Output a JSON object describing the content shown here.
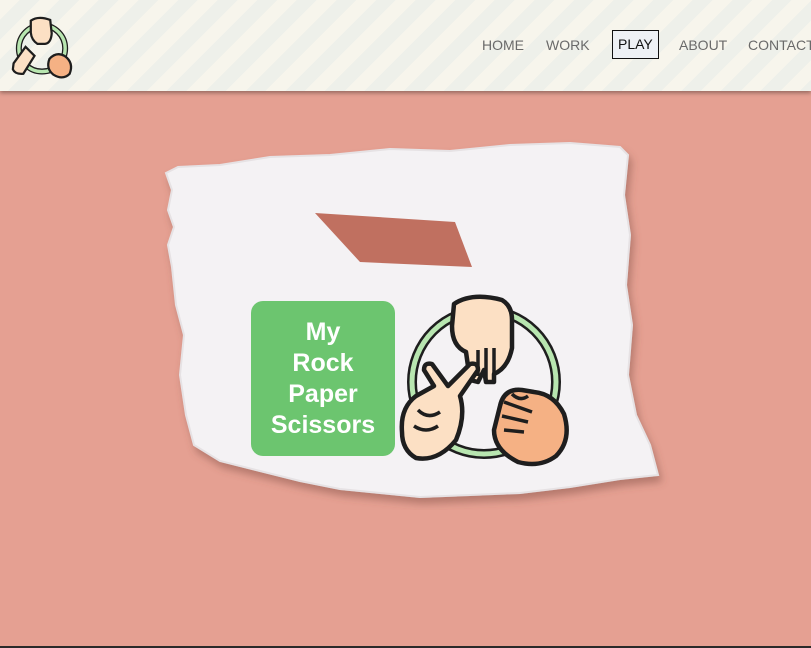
{
  "header": {
    "logo_icon": "rock-paper-scissors-hands-icon",
    "nav": [
      {
        "label": "HOME",
        "active": false
      },
      {
        "label": "WORK",
        "active": false
      },
      {
        "label": "PLAY",
        "active": true
      },
      {
        "label": "ABOUT",
        "active": false
      },
      {
        "label": "CONTACT",
        "active": false
      }
    ]
  },
  "hero": {
    "title_lines": [
      "My",
      "Rock",
      "Paper",
      "Scissors"
    ],
    "illustration_icon": "rock-paper-scissors-hands-icon"
  },
  "colors": {
    "background": "#e5a092",
    "title_box": "#6cc56f",
    "tape": "#c07060",
    "paper": "#f4f2f4"
  }
}
